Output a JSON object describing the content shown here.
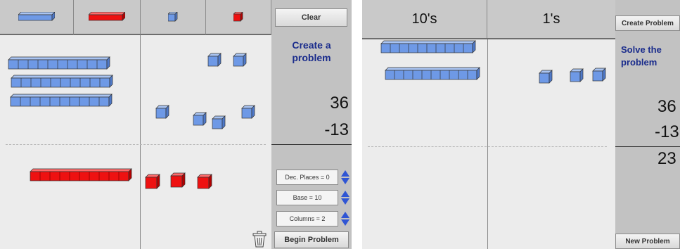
{
  "left": {
    "toolbar": {
      "blue_ten_icon": "blue-ten-rod",
      "red_ten_icon": "red-ten-rod",
      "blue_one_icon": "blue-unit-cube",
      "red_one_icon": "red-unit-cube"
    },
    "sidebar": {
      "clear_label": "Clear",
      "title": "Create a problem",
      "top_number": "36",
      "bottom_number": "-13",
      "dec_places_label": "Dec. Places = 0",
      "base_label": "Base = 10",
      "columns_label": "Columns = 2",
      "begin_label": "Begin Problem"
    }
  },
  "right": {
    "headers": {
      "tens": "10's",
      "ones": "1's"
    },
    "sidebar": {
      "create_label": "Create Problem",
      "title": "Solve the problem",
      "top_number": "36",
      "bottom_number": "-13",
      "result_number": "23",
      "new_label": "New Problem"
    }
  },
  "colors": {
    "blue": "#6e99e6",
    "red": "#ee1111",
    "title_blue": "#1a2c8c"
  }
}
